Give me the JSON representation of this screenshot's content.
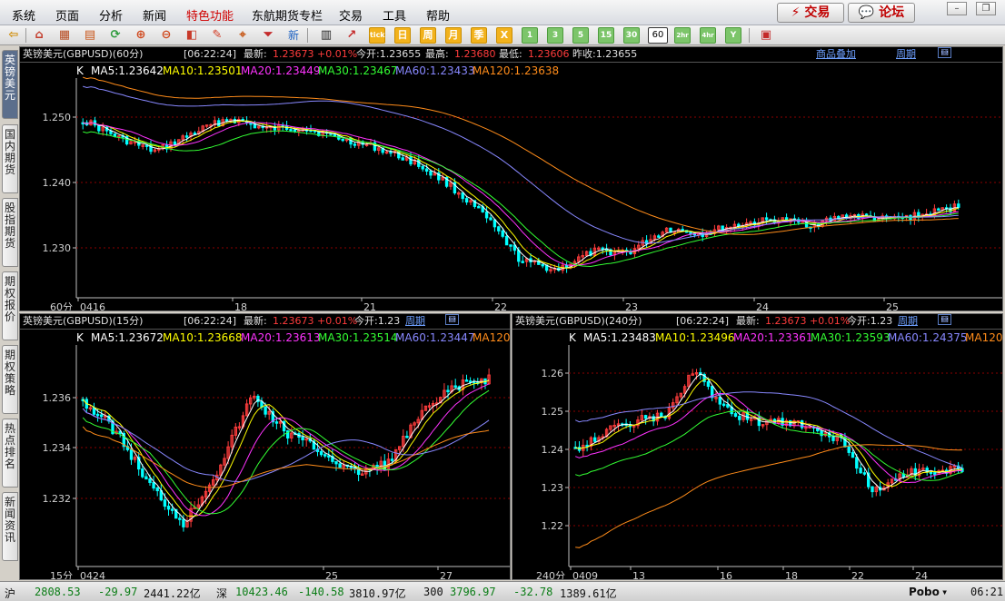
{
  "menu": [
    {
      "label": "系统",
      "active": false
    },
    {
      "label": "页面",
      "active": false
    },
    {
      "label": "分析",
      "active": false
    },
    {
      "label": "新闻",
      "active": false
    },
    {
      "label": "特色功能",
      "active": true
    },
    {
      "label": "东航期货专栏",
      "active": false
    },
    {
      "label": "交易",
      "active": false
    },
    {
      "label": "工具",
      "active": false
    },
    {
      "label": "帮助",
      "active": false
    }
  ],
  "top_buttons": {
    "trade": "⚡ 交易",
    "forum": "💬 论坛"
  },
  "window_controls": {
    "minimize": "–",
    "restore": "❐",
    "close": "✕"
  },
  "toolbar": {
    "new_label": "新",
    "tick": "tick",
    "day": "日",
    "week": "周",
    "month": "月",
    "season": "季",
    "year": "X",
    "min1": "1",
    "min3": "3",
    "min5": "5",
    "min15": "15",
    "min30": "30",
    "min60": "60",
    "h2": "2hr",
    "h4": "4hr",
    "y": "Y"
  },
  "side_tabs": [
    "英镑美元",
    "国内期货",
    "股指期货",
    "期权报价",
    "期权策略",
    "热点排名",
    "新闻资讯"
  ],
  "panels": {
    "top": {
      "title": "英镑美元(GBPUSD)(60分)",
      "time": "[06:22:24]",
      "latest_label": "最新:",
      "latest_value": "1.23673 +0.01%",
      "open_label": "今开:1.23655",
      "high_label": "最高:",
      "high_value": "1.23680",
      "low_label": "最低:",
      "low_value": "1.23606",
      "prev_close": "昨收:1.23655",
      "overlay_link": "商品叠加",
      "period_link": "周期",
      "k_label": "K",
      "ma": [
        {
          "text": "MA5:1.23642",
          "color": "#ffffff"
        },
        {
          "text": "MA10:1.23501",
          "color": "#ffff00"
        },
        {
          "text": "MA20:1.23449",
          "color": "#ff33ff"
        },
        {
          "text": "MA30:1.23467",
          "color": "#33ff33"
        },
        {
          "text": "MA60:1.23433",
          "color": "#8888ff"
        },
        {
          "text": "MA120:1.23638",
          "color": "#ff8c1a"
        }
      ],
      "y_ticks": [
        "1.250",
        "1.240",
        "1.230"
      ],
      "period_corner": "60分",
      "x_labels": [
        "0416",
        "18",
        "21",
        "22",
        "23",
        "24",
        "25"
      ]
    },
    "left": {
      "title": "英镑美元(GBPUSD)(15分)",
      "time": "[06:22:24]",
      "latest_label": "最新:",
      "latest_value": "1.23673 +0.01%",
      "open_label": "今开:1.23",
      "period_link": "周期",
      "k_label": "K",
      "ma": [
        {
          "text": "MA5:1.23672",
          "color": "#ffffff"
        },
        {
          "text": "MA10:1.23668",
          "color": "#ffff00"
        },
        {
          "text": "MA20:1.23613",
          "color": "#ff33ff"
        },
        {
          "text": "MA30:1.23514",
          "color": "#33ff33"
        },
        {
          "text": "MA60:1.23447",
          "color": "#8888ff"
        },
        {
          "text": "MA120:",
          "color": "#ff8c1a"
        }
      ],
      "y_ticks": [
        "1.236",
        "1.234",
        "1.232"
      ],
      "period_corner": "15分",
      "x_labels": [
        "0424",
        "25",
        "27"
      ]
    },
    "right": {
      "title": "英镑美元(GBPUSD)(240分)",
      "time": "[06:22:24]",
      "latest_label": "最新:",
      "latest_value": "1.23673 +0.01%",
      "open_label": "今开:1.23",
      "period_link": "周期",
      "k_label": "K",
      "ma": [
        {
          "text": "MA5:1.23483",
          "color": "#ffffff"
        },
        {
          "text": "MA10:1.23496",
          "color": "#ffff00"
        },
        {
          "text": "MA20:1.23361",
          "color": "#ff33ff"
        },
        {
          "text": "MA30:1.23593",
          "color": "#33ff33"
        },
        {
          "text": "MA60:1.24375",
          "color": "#8888ff"
        },
        {
          "text": "MA120:",
          "color": "#ff8c1a"
        }
      ],
      "y_ticks": [
        "1.26",
        "1.25",
        "1.24",
        "1.23",
        "1.22"
      ],
      "period_corner": "240分",
      "x_labels": [
        "0409",
        "13",
        "16",
        "18",
        "22",
        "24"
      ]
    }
  },
  "status": {
    "sh_label": "沪",
    "sh_index": "2808.53",
    "sh_change": "-29.97",
    "sh_volume": "2441.22亿",
    "sz_label": "深",
    "sz_index": "10423.46",
    "sz_change": "-140.58",
    "sz_volume": "3810.97亿",
    "c300_label": "300",
    "c300_index": "3796.97",
    "c300_change": "-32.78",
    "c300_volume": "1389.61亿",
    "brand": "Pobo",
    "clock": "06:21"
  },
  "colors": {
    "up": "#ff3c3c",
    "down": "#00ffff",
    "grid": "#8b0000",
    "axis": "#c0c0c0",
    "ma120": "#ff8c1a",
    "ma60": "#8888ff"
  }
}
